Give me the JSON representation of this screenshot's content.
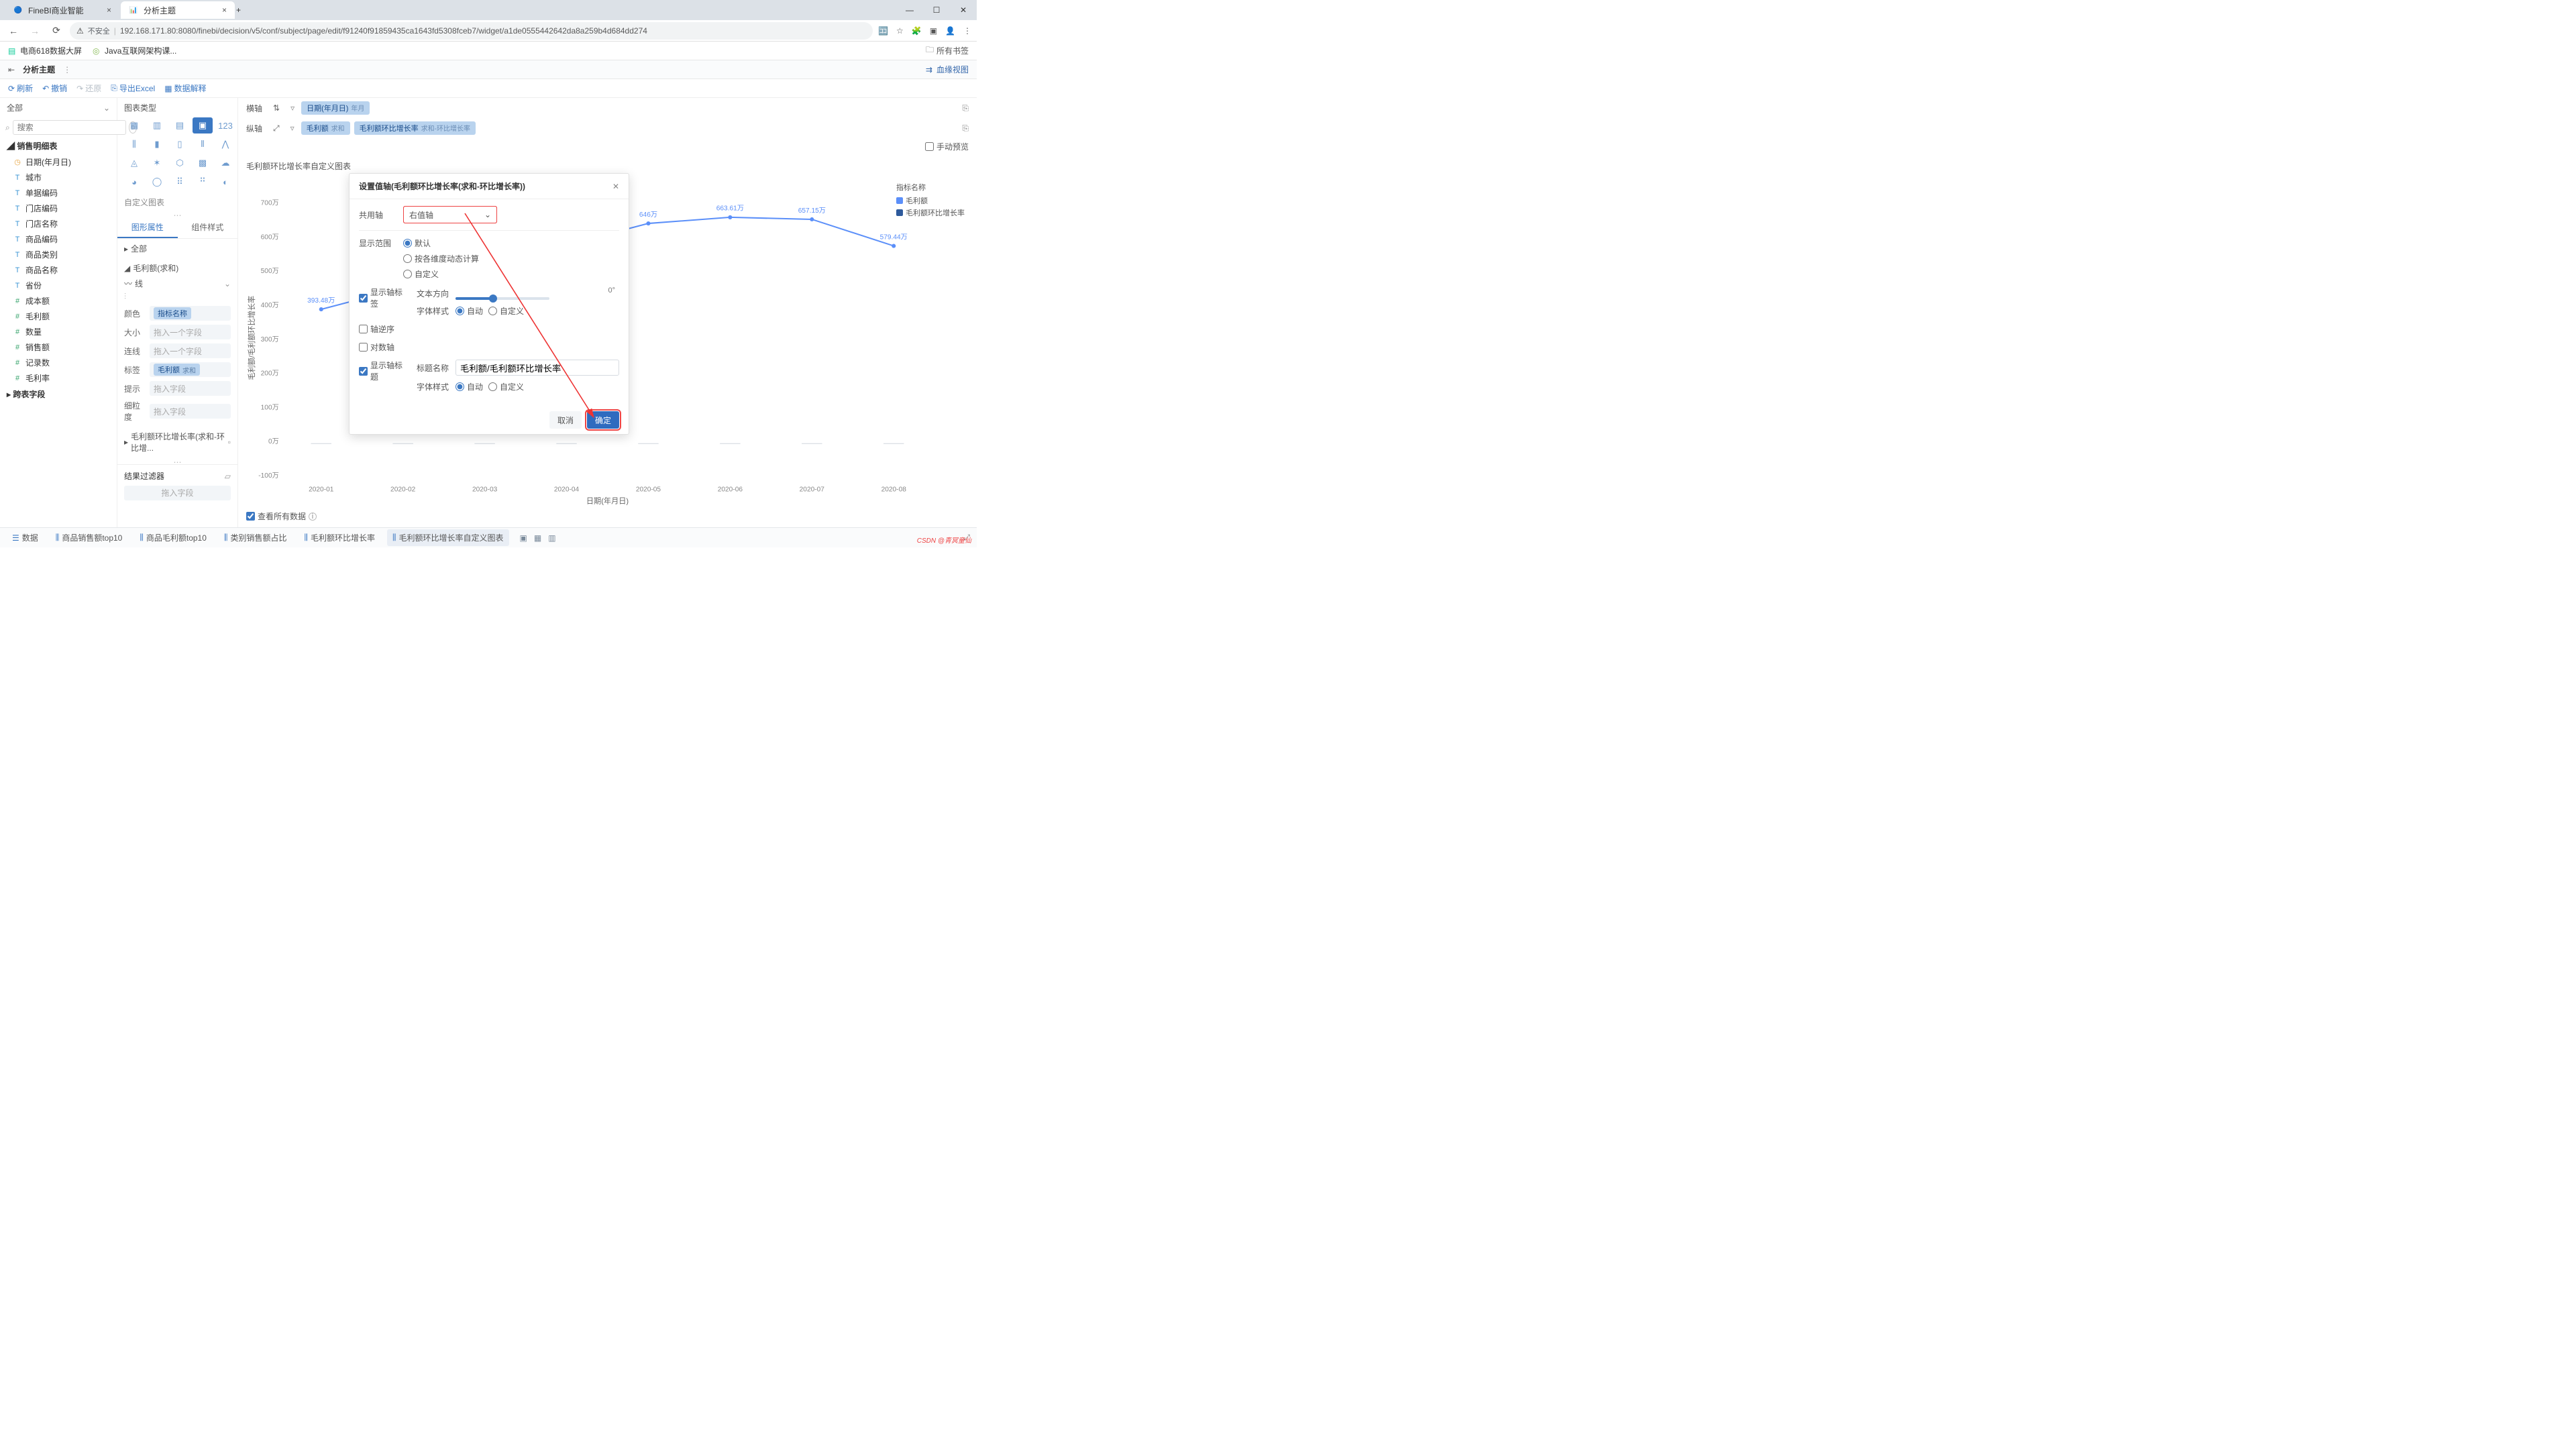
{
  "browser": {
    "tabs": [
      {
        "title": "FineBI商业智能",
        "active": false
      },
      {
        "title": "分析主题",
        "active": true
      }
    ],
    "insecure_prefix": "不安全",
    "url": "192.168.171.80:8080/finebi/decision/v5/conf/subject/page/edit/f91240f91859435ca1643fd5308fceb7/widget/a1de0555442642da8a259b4d684dd274",
    "bookmarks": [
      {
        "label": "电商618数据大屏"
      },
      {
        "label": "Java互联网架构课..."
      }
    ],
    "all_bookmarks": "所有书签"
  },
  "app": {
    "back_icon": "⇤",
    "title": "分析主题",
    "blood_view": "血缘视图"
  },
  "toolbar": {
    "refresh": "刷新",
    "undo": "撤销",
    "redo": "还原",
    "export_excel": "导出Excel",
    "data_explain": "数据解释"
  },
  "left": {
    "all_label": "全部",
    "search_ph": "搜索",
    "group1": "销售明细表",
    "fields": [
      {
        "label": "日期(年月日)",
        "type": "date"
      },
      {
        "label": "城市",
        "type": "text"
      },
      {
        "label": "单据编码",
        "type": "text"
      },
      {
        "label": "门店编码",
        "type": "text"
      },
      {
        "label": "门店名称",
        "type": "text"
      },
      {
        "label": "商品编码",
        "type": "text"
      },
      {
        "label": "商品类别",
        "type": "text"
      },
      {
        "label": "商品名称",
        "type": "text"
      },
      {
        "label": "省份",
        "type": "text"
      },
      {
        "label": "成本额",
        "type": "num"
      },
      {
        "label": "毛利额",
        "type": "num"
      },
      {
        "label": "数量",
        "type": "num"
      },
      {
        "label": "销售额",
        "type": "num"
      },
      {
        "label": "记录数",
        "type": "num"
      },
      {
        "label": "毛利率",
        "type": "num"
      }
    ],
    "group2": "跨表字段"
  },
  "mid": {
    "chart_type_label": "图表类型",
    "custom_chart": "自定义图表",
    "tab_attr": "图形属性",
    "tab_style": "组件样式",
    "sec_all": "全部",
    "sec_profit": "毛利额(求和)",
    "sec_line": "线",
    "rows": {
      "color_lbl": "颜色",
      "color_val": "指标名称",
      "size_lbl": "大小",
      "size_ph": "拖入一个字段",
      "line_lbl": "连线",
      "line_ph": "拖入一个字段",
      "label_lbl": "标签",
      "label_pill": "毛利额",
      "label_agg": "求和",
      "tip_lbl": "提示",
      "tip_ph": "拖入字段",
      "grain_lbl": "细粒度",
      "grain_ph": "拖入字段"
    },
    "sec_profit_growth": "毛利额环比增长率(求和-环比增...",
    "filter_lbl": "结果过滤器",
    "filter_ph": "拖入字段"
  },
  "axes": {
    "x_label": "横轴",
    "x_pill": "日期(年月日)",
    "x_agg": "年月",
    "y_label": "纵轴",
    "y_pill1": "毛利额",
    "y_agg1": "求和",
    "y_pill2": "毛利额环比增长率",
    "y_agg2": "求和-环比增长率",
    "manual_preview": "手动预览"
  },
  "chart_data": {
    "type": "line",
    "title": "毛利额环比增长率自定义图表",
    "xlabel": "日期(年月日)",
    "ylabel": "毛利额/毛利额环比增长率",
    "categories": [
      "2020-01",
      "2020-02",
      "2020-03",
      "2020-04",
      "2020-05",
      "2020-06",
      "2020-07",
      "2020-08"
    ],
    "series": [
      {
        "name": "毛利额",
        "values": [
          393.48,
          null,
          null,
          null,
          646,
          663.61,
          657.15,
          579.44
        ],
        "unit": "万"
      },
      {
        "name": "毛利额环比增长率",
        "values": [
          null,
          null,
          null,
          null,
          null,
          null,
          null,
          null
        ]
      }
    ],
    "data_labels": [
      "393.48万",
      "",
      "",
      "",
      "646万",
      "663.61万",
      "657.15万",
      "579.44万"
    ],
    "ylim": [
      -100,
      700
    ],
    "y_ticks": [
      "-100万",
      "0万",
      "100万",
      "200万",
      "300万",
      "400万",
      "500万",
      "600万",
      "700万"
    ],
    "legend_title": "指标名称"
  },
  "view_all": "查看所有数据",
  "bottom_tabs": {
    "data": "数据",
    "tabs": [
      "商品销售额top10",
      "商品毛利额top10",
      "类别销售额占比",
      "毛利额环比增长率",
      "毛利额环比增长率自定义图表"
    ]
  },
  "modal": {
    "title": "设置值轴(毛利额环比增长率(求和-环比增长率))",
    "share_axis_lbl": "共用轴",
    "share_axis_val": "右值轴",
    "range_lbl": "显示范围",
    "range_default": "默认",
    "range_bydim": "按各维度动态计算",
    "range_custom": "自定义",
    "show_axis_label": "显示轴标签",
    "text_dir_lbl": "文本方向",
    "text_dir_val": "0°",
    "font_style_lbl": "字体样式",
    "font_auto": "自动",
    "font_custom": "自定义",
    "reverse": "轴逆序",
    "log": "对数轴",
    "show_title": "显示轴标题",
    "title_name_lbl": "标题名称",
    "title_name_val": "毛利额/毛利额环比增长率",
    "cancel": "取消",
    "ok": "确定"
  },
  "watermark": "CSDN @青冥童仙"
}
